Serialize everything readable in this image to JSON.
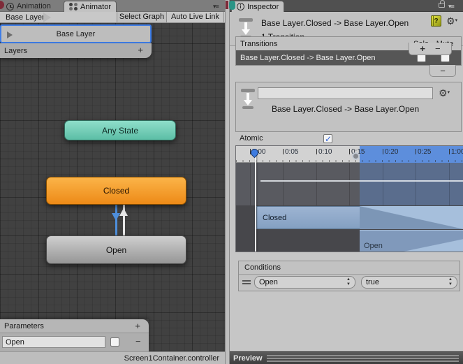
{
  "animator": {
    "tabs": {
      "animation": "Animation",
      "animator": "Animator"
    },
    "breadcrumb": "Base Layer",
    "toolbar": {
      "select_graph": "Select Graph",
      "auto_live_link": "Auto Live Link"
    },
    "layers": {
      "selected_layer": "Base Layer",
      "header": "Layers"
    },
    "graph": {
      "nodes": {
        "any_state": "Any State",
        "closed": "Closed",
        "open": "Open"
      }
    },
    "parameters": {
      "header": "Parameters",
      "name": "Open",
      "checked": false
    },
    "status_bar": "Screen1Container.controller"
  },
  "inspector": {
    "tab": "Inspector",
    "header": {
      "title": "Base Layer.Closed -> Base Layer.Open",
      "subtitle": "1 Transition"
    },
    "transitions": {
      "title": "Transitions",
      "solo": "Solo",
      "mute": "Mute",
      "row": {
        "label": "Base Layer.Closed -> Base Layer.Open",
        "solo_checked": false,
        "mute_checked": false
      }
    },
    "detail": {
      "name_value": "",
      "title": "Base Layer.Closed -> Base Layer.Open"
    },
    "atomic": {
      "label": "Atomic",
      "checked": true
    },
    "timeline": {
      "ticks": [
        "0:00",
        "0:05",
        "0:10",
        "0:15",
        "0:20",
        "0:25",
        "1:00"
      ],
      "source_clip": "Closed",
      "target_clip": "Open",
      "transition_start_tick": "0:15",
      "playhead_tick": "0:01"
    },
    "conditions": {
      "title": "Conditions",
      "row": {
        "parameter": "Open",
        "value": "true"
      }
    },
    "preview": "Preview"
  },
  "icons": {
    "pane_menu": "▾≡",
    "add": "+",
    "remove": "−",
    "gear": "⚙",
    "gear_caret": "▾",
    "info": "i",
    "help": "?",
    "popup_arrows": "▲\n▼"
  },
  "colors": {
    "selection_blue": "#3e7de7",
    "ruler_blue": "#5d8edc",
    "clip_bar_blue": "#8ca7c7",
    "node_any_state": "#6fcdb5",
    "node_closed": "#f49c2a",
    "node_open": "#ababab",
    "graph_bg": "#414141"
  }
}
